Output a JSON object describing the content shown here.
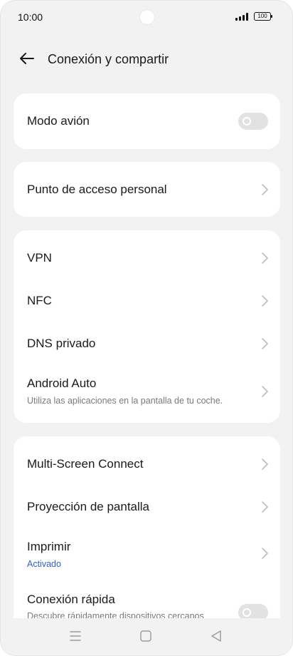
{
  "status_bar": {
    "time": "10:00",
    "battery": "100"
  },
  "header": {
    "title": "Conexión y compartir",
    "back_icon": "arrow-left-icon"
  },
  "sections": {
    "airplane": {
      "label": "Modo avión",
      "enabled": false
    },
    "hotspot": {
      "label": "Punto de acceso personal"
    },
    "network": {
      "vpn": "VPN",
      "nfc": "NFC",
      "private_dns": "DNS privado",
      "android_auto": {
        "label": "Android Auto",
        "subtitle": "Utiliza las aplicaciones en la pantalla de tu coche."
      }
    },
    "devices": {
      "multi_screen": "Multi-Screen Connect",
      "screen_cast": "Proyección de pantalla",
      "print": {
        "label": "Imprimir",
        "status": "Activado"
      },
      "quick_connect": {
        "label": "Conexión rápida",
        "subtitle": "Descubre rápidamente dispositivos cercanos",
        "enabled": false
      }
    }
  },
  "nav_bar": {
    "menu_icon": "menu-icon",
    "home_icon": "home-icon",
    "back_icon": "back-triangle-icon"
  },
  "colors": {
    "background": "#f2f2f2",
    "card": "#ffffff",
    "accent": "#2f5fd0",
    "toggle_off": "#e2e2e2"
  }
}
